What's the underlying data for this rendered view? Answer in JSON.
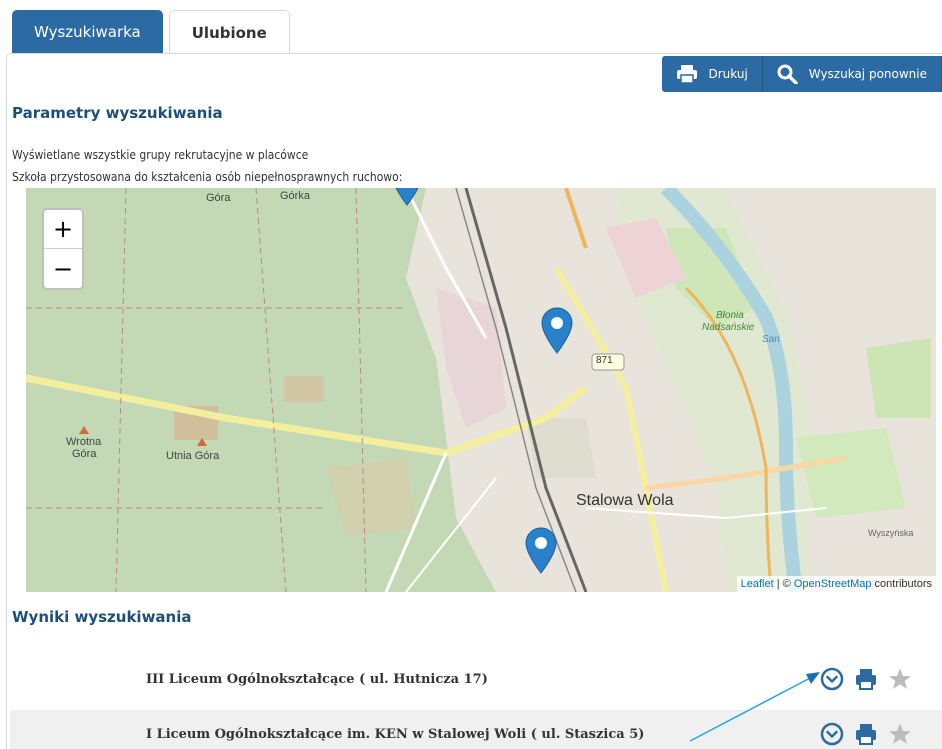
{
  "tabs": [
    {
      "label": "Wyszukiwarka",
      "active": true
    },
    {
      "label": "Ulubione",
      "active": false
    }
  ],
  "toolbar": {
    "print_label": "Drukuj",
    "search_again_label": "Wyszukaj ponownie"
  },
  "params": {
    "title": "Parametry wyszukiwania",
    "line1": "Wyświetlane wszystkie grupy rekrutacyjne w placówce",
    "line2": "Szkoła przystosowana do kształcenia osób niepełnosprawnych ruchowo:"
  },
  "map": {
    "zoom_in": "+",
    "zoom_out": "−",
    "labels": {
      "gora1": "Góra",
      "gorka": "Górka",
      "wrotna1": "Wrotna",
      "wrotna2": "Góra",
      "utnia": "Utnia Góra",
      "blonia1": "Błonia",
      "blonia2": "Nadsańskie",
      "san": "San",
      "road": "871",
      "city": "Stalowa Wola",
      "street": "Wyszyńska"
    },
    "attribution": {
      "leaflet": "Leaflet",
      "sep": " | © ",
      "osm": "OpenStreetMap",
      "contrib": " contributors"
    },
    "colors": {
      "forest": "#c3d9b5",
      "marker": "#2a81cb",
      "road": "#f7f7a1"
    }
  },
  "results": {
    "title": "Wyniki wyszukiwania",
    "items": [
      {
        "name": "III Liceum Ogólnokształcące ( ul. Hutnicza 17)"
      },
      {
        "name": "I Liceum Ogólnokształcące im. KEN w Stalowej Woli ( ul. Staszica 5)"
      }
    ]
  },
  "colors": {
    "accent": "#2c6aa3",
    "heading": "#1e4f78",
    "annotation_arrow": "#29a3e0"
  }
}
